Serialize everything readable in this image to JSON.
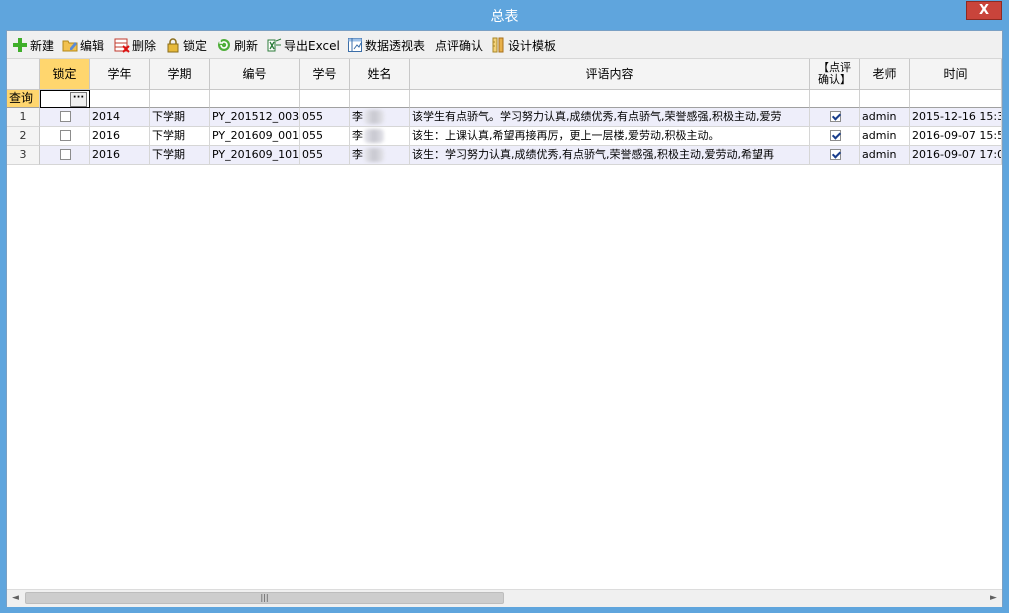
{
  "window": {
    "title": "总表",
    "close_label": "X"
  },
  "toolbar": {
    "new_label": "新建",
    "edit_label": "编辑",
    "delete_label": "删除",
    "lock_label": "锁定",
    "refresh_label": "刷新",
    "export_label": "导出Excel",
    "pivot_label": "数据透视表",
    "confirm_label": "点评确认",
    "design_label": "设计模板"
  },
  "grid": {
    "columns": [
      "锁定",
      "学年",
      "学期",
      "编号",
      "学号",
      "姓名",
      "评语内容",
      "【点评确认】",
      "老师",
      "时间"
    ],
    "confirm_header_line1": "【点评",
    "confirm_header_line2": "确认】",
    "filter_label": "查询",
    "filter_button": "···",
    "rows": [
      {
        "n": "1",
        "locked": false,
        "year": "2014",
        "term": "下学期",
        "code": "PY_201512_003",
        "student_no": "055",
        "name": "李",
        "comment": "该学生有点骄气。学习努力认真,成绩优秀,有点骄气,荣誉感强,积极主动,爱劳",
        "confirmed": true,
        "teacher": "admin",
        "time": "2015-12-16 15:3"
      },
      {
        "n": "2",
        "locked": false,
        "year": "2016",
        "term": "下学期",
        "code": "PY_201609_001",
        "student_no": "055",
        "name": "李",
        "comment": "该生：上课认真,希望再接再厉，更上一层楼,爱劳动,积极主动。",
        "confirmed": true,
        "teacher": "admin",
        "time": "2016-09-07 15:5"
      },
      {
        "n": "3",
        "locked": false,
        "year": "2016",
        "term": "下学期",
        "code": "PY_201609_101",
        "student_no": "055",
        "name": "李",
        "comment": "该生：学习努力认真,成绩优秀,有点骄气,荣誉感强,积极主动,爱劳动,希望再",
        "confirmed": true,
        "teacher": "admin",
        "time": "2016-09-07 17:0"
      }
    ]
  },
  "scrollbar": {
    "left_arrow": "◄",
    "right_arrow": "►",
    "grip": "|||"
  },
  "colors": {
    "titlebar": "#5fa5dd",
    "close": "#c9443b",
    "selected_header": "#ffd66e",
    "alt_row": "#eeeefa"
  }
}
